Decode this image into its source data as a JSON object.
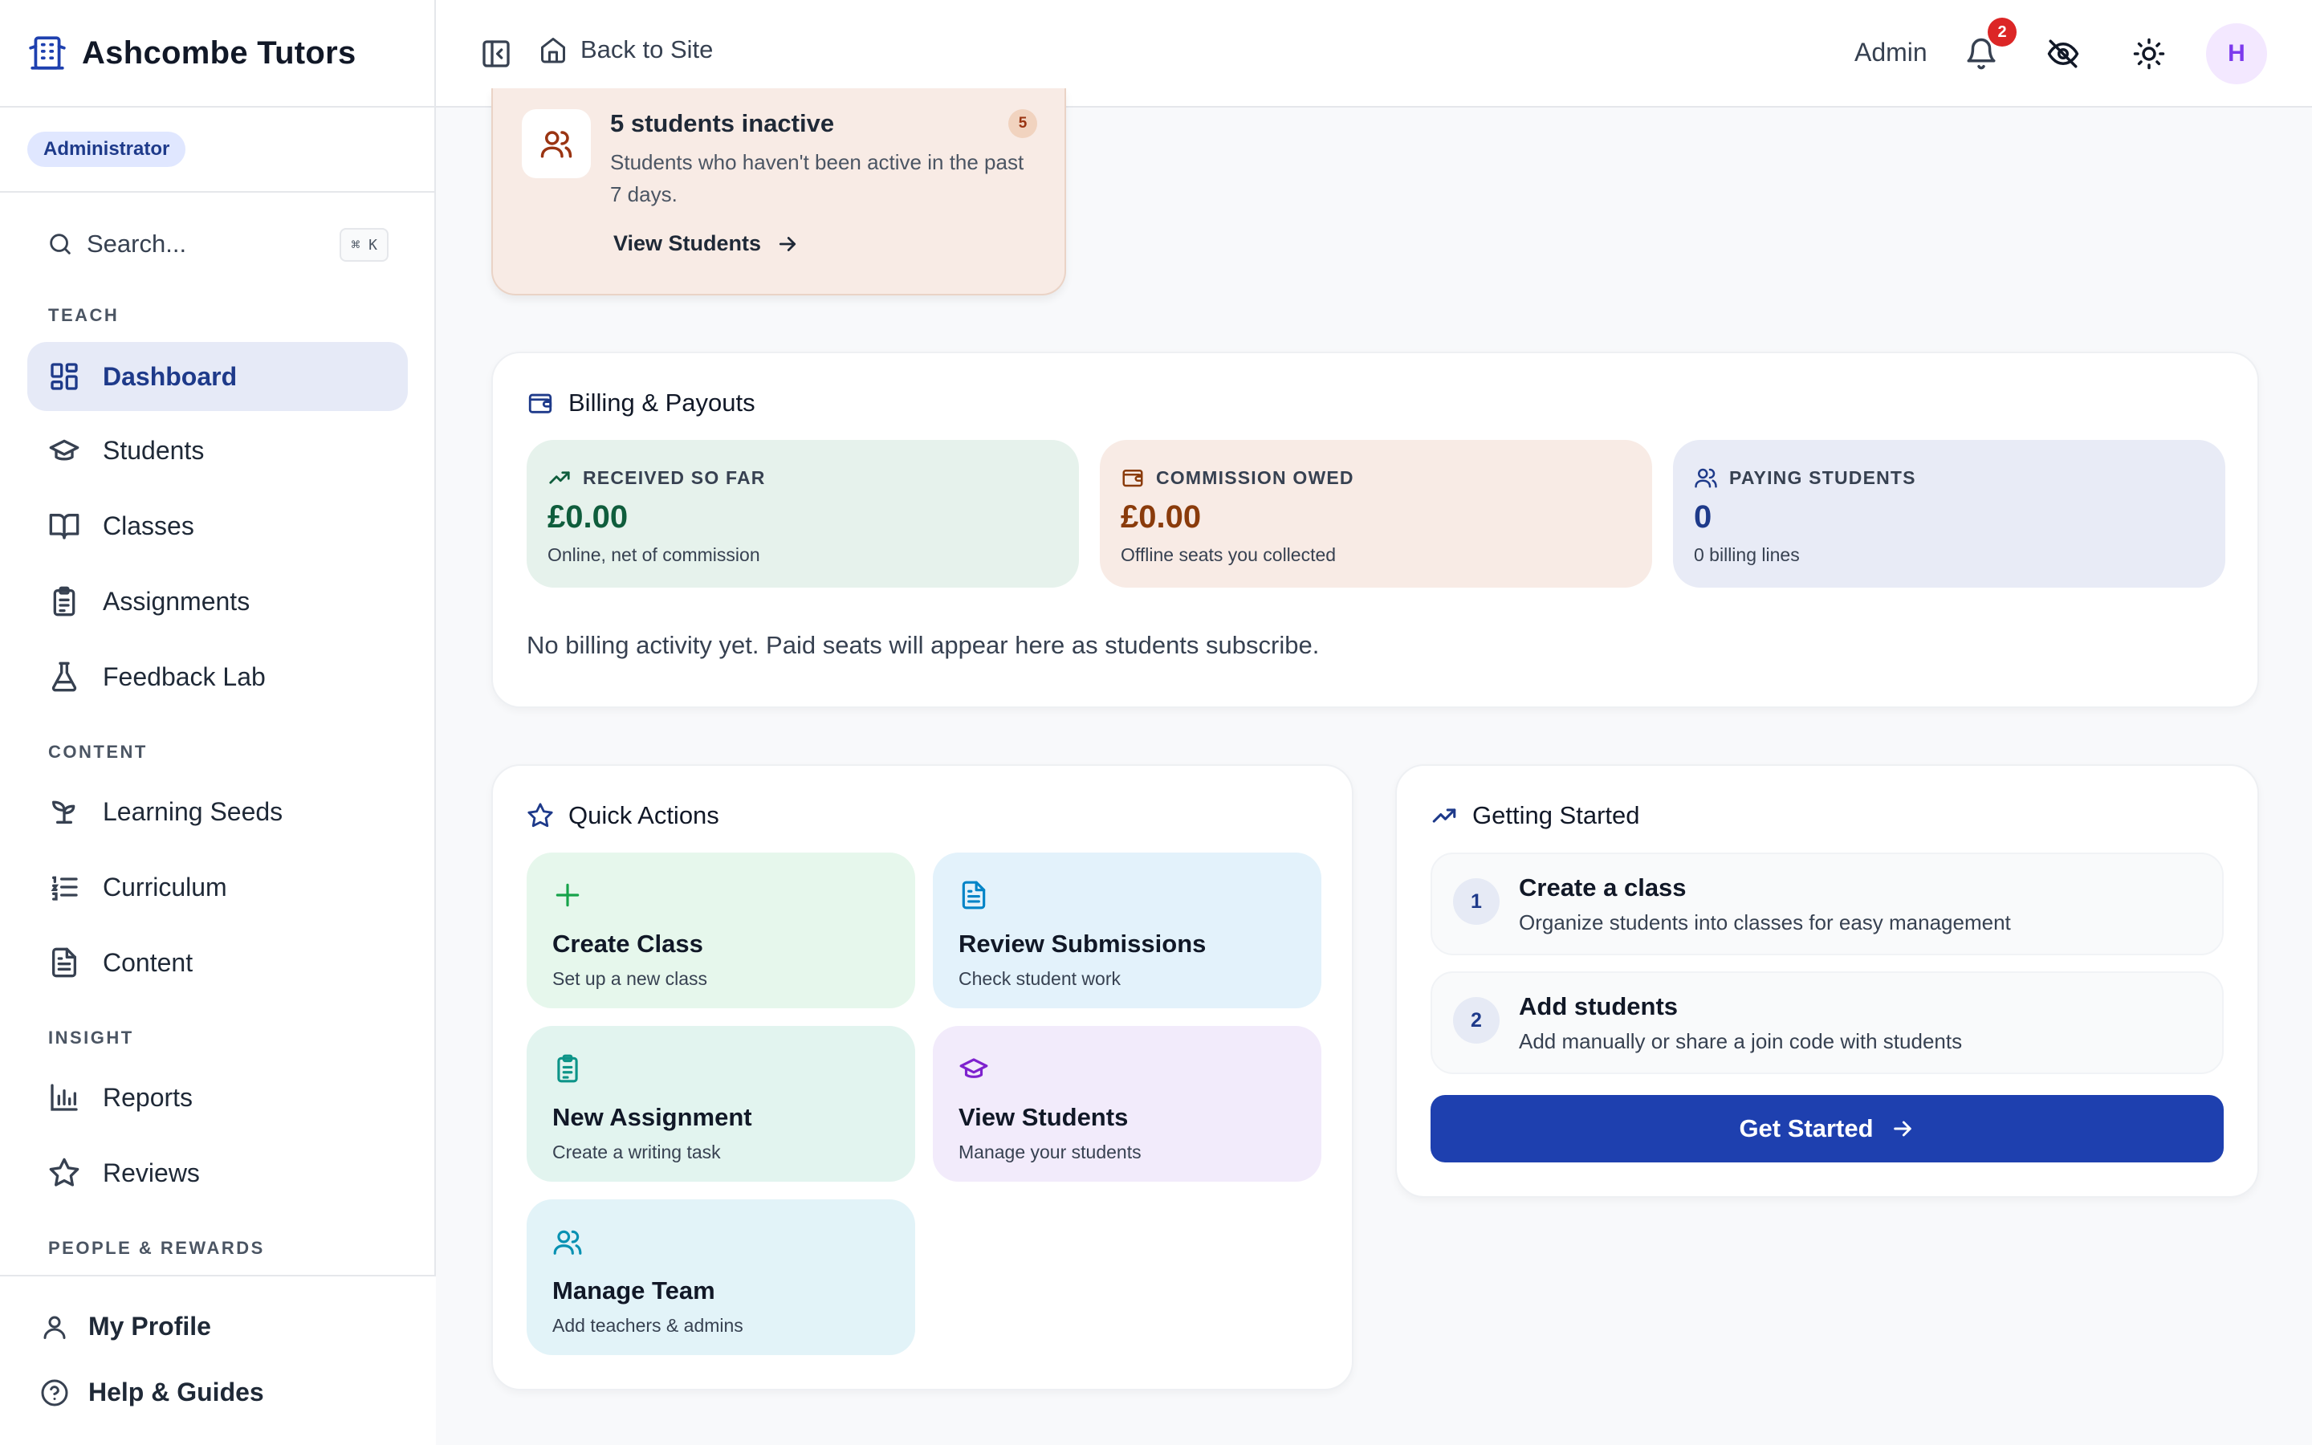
{
  "brand": {
    "name": "Ashcombe Tutors"
  },
  "role": "Administrator",
  "search": {
    "placeholder": "Search...",
    "shortcut": "⌘ K"
  },
  "sidebar": {
    "sections": [
      "TEACH",
      "CONTENT",
      "INSIGHT",
      "PEOPLE & REWARDS"
    ],
    "items": [
      {
        "label": "Dashboard",
        "active": true
      },
      {
        "label": "Students"
      },
      {
        "label": "Classes"
      },
      {
        "label": "Assignments"
      },
      {
        "label": "Feedback Lab"
      },
      {
        "label": "Learning Seeds"
      },
      {
        "label": "Curriculum"
      },
      {
        "label": "Content"
      },
      {
        "label": "Reports"
      },
      {
        "label": "Reviews"
      }
    ],
    "footer": [
      {
        "label": "My Profile"
      },
      {
        "label": "Help & Guides"
      }
    ]
  },
  "topbar": {
    "back_label": "Back to Site",
    "admin_label": "Admin",
    "notifications": "2",
    "avatar_initial": "H"
  },
  "alert": {
    "title": "5 students inactive",
    "count": "5",
    "description": "Students who haven't been active in the past 7 days.",
    "link": "View Students"
  },
  "billing": {
    "title": "Billing & Payouts",
    "stats": [
      {
        "label": "RECEIVED SO FAR",
        "value": "£0.00",
        "sub": "Online, net of commission",
        "color": "#0f5d3c",
        "bg": "#e6f2ec"
      },
      {
        "label": "COMMISSION OWED",
        "value": "£0.00",
        "sub": "Offline seats you collected",
        "color": "#8a3b0b",
        "bg": "#f8ebe5"
      },
      {
        "label": "PAYING STUDENTS",
        "value": "0",
        "sub": "0 billing lines",
        "color": "#1e3a8a",
        "bg": "#e8ebf6"
      }
    ],
    "note": "No billing activity yet. Paid seats will appear here as students subscribe."
  },
  "quick_actions": {
    "title": "Quick Actions",
    "items": [
      {
        "title": "Create Class",
        "sub": "Set up a new class",
        "bg": "#e6f7ec",
        "icon_color": "#16a34a"
      },
      {
        "title": "Review Submissions",
        "sub": "Check student work",
        "bg": "#e3f2fb",
        "icon_color": "#0284c7"
      },
      {
        "title": "New Assignment",
        "sub": "Create a writing task",
        "bg": "#e2f4ef",
        "icon_color": "#0d9488"
      },
      {
        "title": "View Students",
        "sub": "Manage your students",
        "bg": "#f2ebfb",
        "icon_color": "#7e22ce"
      },
      {
        "title": "Manage Team",
        "sub": "Add teachers & admins",
        "bg": "#e2f3f8",
        "icon_color": "#0891b2"
      }
    ]
  },
  "getting_started": {
    "title": "Getting Started",
    "steps": [
      {
        "num": "1",
        "title": "Create a class",
        "sub": "Organize students into classes for easy management"
      },
      {
        "num": "2",
        "title": "Add students",
        "sub": "Add manually or share a join code with students"
      }
    ],
    "cta": "Get Started"
  },
  "colors": {
    "primary": "#1e40af",
    "active_nav_bg": "#e6eaf7",
    "alert_bg": "#f8ebe5"
  }
}
